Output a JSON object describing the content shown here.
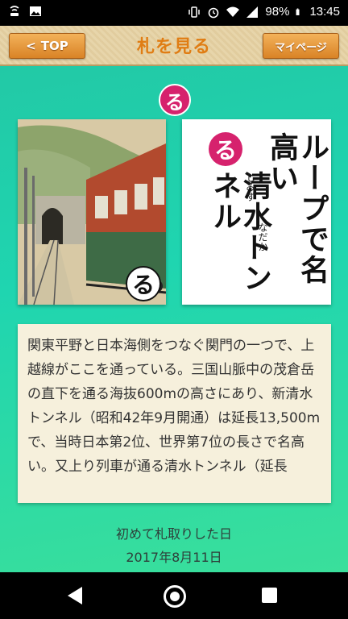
{
  "status_bar": {
    "battery": "98%",
    "time": "13:45",
    "icons_left": [
      "wifi-call-icon",
      "image-icon"
    ],
    "icons_right": [
      "vibrate-icon",
      "alarm-icon",
      "wifi-icon",
      "signal-icon",
      "battery-icon"
    ]
  },
  "header": {
    "back_label": "TOP",
    "title": "札を見る",
    "mypage_label": "マイページ",
    "accent": "#e07d14"
  },
  "card": {
    "letter": "る",
    "reading_lines": [
      "ループで名高い",
      "清水トンネル"
    ],
    "ruby": [
      "なだか",
      "しみず"
    ],
    "picture_letter": "る",
    "accent": "#d6226d"
  },
  "description": "関東平野と日本海側をつなぐ関門の一つで、上越線がここを通っている。三国山脈中の茂倉岳の直下を通る海抜600mの高さにあり、新清水トンネル（昭和42年9月開通）は延長13,500mで、当時日本第2位、世界第7位の長さで名高い。又上り列車が通る清水トンネル（延長",
  "first_acquired": {
    "label": "初めて札取りした日",
    "date": "2017年8月11日"
  }
}
